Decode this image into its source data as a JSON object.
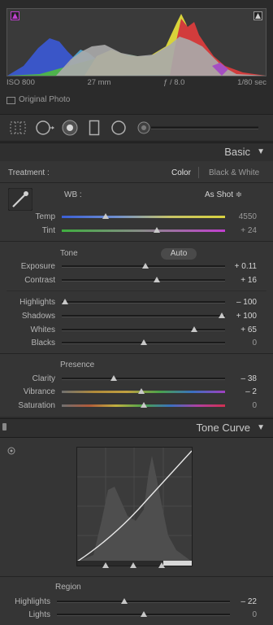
{
  "histogram": {
    "meta": {
      "iso": "ISO 800",
      "focal": "27 mm",
      "aperture": "ƒ / 8.0",
      "shutter": "1/80 sec"
    },
    "original_photo_label": "Original Photo"
  },
  "basic": {
    "header_title": "Basic",
    "treatment_label": "Treatment :",
    "treatment_color": "Color",
    "treatment_bw": "Black & White",
    "wb_label": "WB :",
    "wb_value": "As Shot ≑",
    "tone_label": "Tone",
    "auto_label": "Auto",
    "presence_label": "Presence",
    "sliders": {
      "temp": {
        "label": "Temp",
        "value": "4550",
        "pos": 0.27
      },
      "tint": {
        "label": "Tint",
        "value": "+ 24",
        "pos": 0.58
      },
      "exposure": {
        "label": "Exposure",
        "value": "+ 0.11",
        "pos": 0.51
      },
      "contrast": {
        "label": "Contrast",
        "value": "+ 16",
        "pos": 0.58
      },
      "highlights": {
        "label": "Highlights",
        "value": "– 100",
        "pos": 0.02
      },
      "shadows": {
        "label": "Shadows",
        "value": "+ 100",
        "pos": 0.98
      },
      "whites": {
        "label": "Whites",
        "value": "+ 65",
        "pos": 0.81
      },
      "blacks": {
        "label": "Blacks",
        "value": "0",
        "pos": 0.5
      },
      "clarity": {
        "label": "Clarity",
        "value": "– 38",
        "pos": 0.32
      },
      "vibrance": {
        "label": "Vibrance",
        "value": "– 2",
        "pos": 0.49
      },
      "saturation": {
        "label": "Saturation",
        "value": "0",
        "pos": 0.5
      }
    }
  },
  "tone_curve": {
    "header_title": "Tone Curve",
    "region_label": "Region",
    "sliders": {
      "highlights": {
        "label": "Highlights",
        "value": "– 22",
        "pos": 0.39
      },
      "lights": {
        "label": "Lights",
        "value": "0",
        "pos": 0.5
      }
    }
  },
  "colors": {
    "accent_purple": "#c03fd0",
    "panel_bg": "#353535"
  }
}
